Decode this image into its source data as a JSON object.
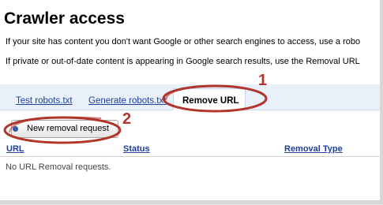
{
  "page": {
    "title": "Crawler access",
    "intro_lines": [
      "If your site has content you don't want Google or other search engines to access, use a robo",
      "If private or out-of-date content is appearing in Google search results, use the Removal URL"
    ]
  },
  "tabs": [
    {
      "label": "Test robots.txt",
      "active": false
    },
    {
      "label": "Generate robots.txt",
      "active": false
    },
    {
      "label": "Remove URL",
      "active": true
    }
  ],
  "actions": {
    "new_request_label": "New removal request"
  },
  "table": {
    "columns": [
      "URL",
      "Status",
      "Removal Type"
    ],
    "empty_message": "No URL Removal requests."
  },
  "annotations": {
    "number_1": "1",
    "number_2": "2",
    "color": "#b0352b"
  },
  "colors": {
    "link": "#1f3f9b",
    "tab_bar": "#e8f0fa"
  }
}
